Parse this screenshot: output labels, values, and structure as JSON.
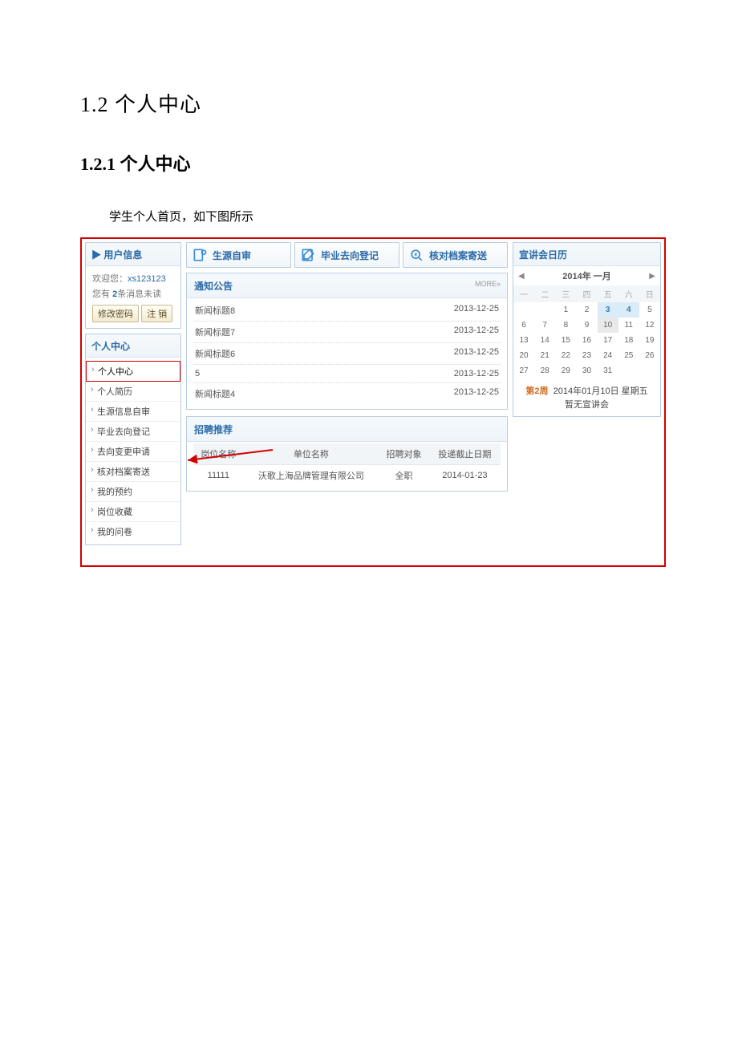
{
  "doc": {
    "h1": "1.2 个人中心",
    "h2": "1.2.1 个人中心",
    "intro": "学生个人首页，如下图所示"
  },
  "userinfo": {
    "title": "▶ 用户信息",
    "welcome_label": "欢迎您：",
    "username": "xs123123",
    "msg_prefix": "您有 ",
    "msg_count": "2",
    "msg_suffix": "条消息未读",
    "changepw": "修改密码",
    "logout": "注 销"
  },
  "menu": {
    "title": "个人中心",
    "items": [
      {
        "label": "个人中心",
        "active": true
      },
      {
        "label": "个人简历"
      },
      {
        "label": "生源信息自审"
      },
      {
        "label": "毕业去向登记"
      },
      {
        "label": "去向变更申请"
      },
      {
        "label": "核对档案寄送"
      },
      {
        "label": "我的预约"
      },
      {
        "label": "岗位收藏"
      },
      {
        "label": "我的问卷"
      }
    ]
  },
  "actions": [
    {
      "label": "生源自审"
    },
    {
      "label": "毕业去向登记"
    },
    {
      "label": "核对档案寄送"
    }
  ],
  "notice": {
    "title": "通知公告",
    "more": "MORE»",
    "items": [
      {
        "title": "新闻标题8",
        "date": "2013-12-25"
      },
      {
        "title": "新闻标题7",
        "date": "2013-12-25"
      },
      {
        "title": "新闻标题6",
        "date": "2013-12-25"
      },
      {
        "title": "5",
        "date": "2013-12-25"
      },
      {
        "title": "新闻标题4",
        "date": "2013-12-25"
      }
    ]
  },
  "jobs": {
    "title": "招聘推荐",
    "headers": [
      "岗位名称",
      "单位名称",
      "招聘对象",
      "投递截止日期"
    ],
    "rows": [
      [
        "11111",
        "沃歌上海品牌管理有限公司",
        "全职",
        "2014-01-23"
      ]
    ]
  },
  "calendar": {
    "title": "宣讲会日历",
    "prev": "◀",
    "next": "▶",
    "ym": "2014年 一月",
    "dow": [
      "一",
      "二",
      "三",
      "四",
      "五",
      "六",
      "日"
    ],
    "weeks": [
      [
        {
          "d": ""
        },
        {
          "d": ""
        },
        {
          "d": "1"
        },
        {
          "d": "2"
        },
        {
          "d": "3",
          "cls": "today"
        },
        {
          "d": "4",
          "cls": "today"
        },
        {
          "d": "5"
        }
      ],
      [
        {
          "d": "6"
        },
        {
          "d": "7"
        },
        {
          "d": "8"
        },
        {
          "d": "9"
        },
        {
          "d": "10",
          "cls": "busy"
        },
        {
          "d": "11"
        },
        {
          "d": "12"
        }
      ],
      [
        {
          "d": "13"
        },
        {
          "d": "14"
        },
        {
          "d": "15"
        },
        {
          "d": "16"
        },
        {
          "d": "17"
        },
        {
          "d": "18"
        },
        {
          "d": "19"
        }
      ],
      [
        {
          "d": "20"
        },
        {
          "d": "21"
        },
        {
          "d": "22"
        },
        {
          "d": "23"
        },
        {
          "d": "24"
        },
        {
          "d": "25"
        },
        {
          "d": "26"
        }
      ],
      [
        {
          "d": "27"
        },
        {
          "d": "28"
        },
        {
          "d": "29"
        },
        {
          "d": "30"
        },
        {
          "d": "31"
        },
        {
          "d": ""
        },
        {
          "d": ""
        }
      ]
    ],
    "foot_week": "第2周",
    "foot_date": "2014年01月10日 星期五",
    "foot_empty": "暂无宣讲会"
  }
}
